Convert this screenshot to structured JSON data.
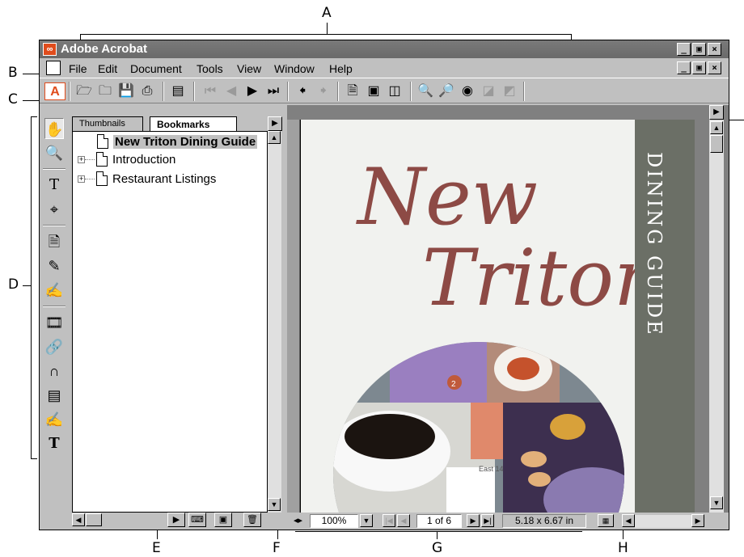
{
  "callouts": {
    "a": "A",
    "b": "B",
    "c": "C",
    "d": "D",
    "e": "E",
    "f": "F",
    "g": "G",
    "h": "H"
  },
  "window": {
    "title": "Adobe Acrobat",
    "minimize": "_",
    "restore": "▣",
    "close": "×"
  },
  "menu": {
    "items": [
      {
        "label": "File"
      },
      {
        "label": "Edit"
      },
      {
        "label": "Document"
      },
      {
        "label": "Tools"
      },
      {
        "label": "View"
      },
      {
        "label": "Window"
      },
      {
        "label": "Help"
      }
    ]
  },
  "toolbar": {
    "icons": [
      "open-icon",
      "open-web-icon",
      "save-icon",
      "print-icon",
      "show-hide-nav-icon",
      "first-page-icon",
      "previous-page-icon",
      "next-page-icon",
      "last-page-icon",
      "go-back-icon",
      "go-forward-icon",
      "actual-size-icon",
      "fit-page-icon",
      "fit-width-icon",
      "find-icon",
      "search-icon",
      "search-results-icon",
      "previous-highlight-icon",
      "next-highlight-icon"
    ]
  },
  "navpane": {
    "tabs": [
      {
        "label": "Thumbnails"
      },
      {
        "label": "Bookmarks"
      }
    ],
    "bookmarks": [
      {
        "label": "New Triton Dining Guide"
      },
      {
        "label": "Introduction"
      },
      {
        "label": "Restaurant Listings"
      }
    ]
  },
  "document": {
    "cover_title_line1": "New",
    "cover_title_line2": "Triton",
    "cover_side_text": "DINING GUIDE",
    "photo_number": "2",
    "photo_street": "East 14"
  },
  "status": {
    "zoom": "100%",
    "page": "1 of 6",
    "page_size": "5.18 x 6.67 in"
  },
  "colors": {
    "title_red": "#8d4a45",
    "band_gray": "#6b6f66",
    "acrobat_red": "#e04c1c"
  }
}
